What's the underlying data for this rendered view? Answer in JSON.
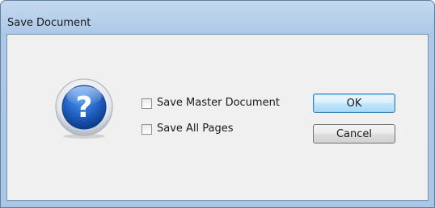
{
  "window": {
    "title": "Save Document"
  },
  "dialog": {
    "icon": "question-icon",
    "options": [
      {
        "label": "Save Master Document",
        "checked": false
      },
      {
        "label": "Save All Pages",
        "checked": false
      }
    ],
    "buttons": {
      "ok_label": "OK",
      "cancel_label": "Cancel"
    }
  },
  "colors": {
    "frame": "#a9c6e5",
    "client_bg": "#f0f0f0",
    "icon_blue": "#1f5fc0"
  }
}
